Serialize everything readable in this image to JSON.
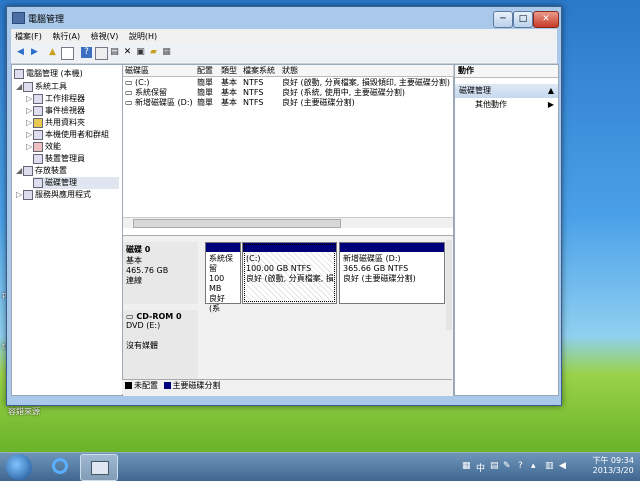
{
  "window": {
    "title": "電腦管理",
    "controls": {
      "minimize": "─",
      "maximize": "□",
      "close": "✕"
    }
  },
  "menu": [
    "檔案(F)",
    "執行(A)",
    "檢視(V)",
    "說明(H)"
  ],
  "toolbar_icons": [
    "back-icon",
    "forward-icon",
    "up-icon",
    "show-hide-tree-icon",
    "help-icon",
    "properties-icon",
    "connect-icon",
    "delete-icon",
    "open-icon",
    "export-icon",
    "settings-icon"
  ],
  "tree": [
    {
      "label": "電腦管理 (本機)",
      "level": 0
    },
    {
      "label": "系統工具",
      "level": 1
    },
    {
      "label": "工作排程器",
      "level": 2
    },
    {
      "label": "事件檢視器",
      "level": 2
    },
    {
      "label": "共用資料夾",
      "level": 2
    },
    {
      "label": "本機使用者和群組",
      "level": 2
    },
    {
      "label": "效能",
      "level": 2
    },
    {
      "label": "裝置管理員",
      "level": 2
    },
    {
      "label": "存放裝置",
      "level": 1
    },
    {
      "label": "磁碟管理",
      "level": 2
    },
    {
      "label": "服務與應用程式",
      "level": 1
    }
  ],
  "volume_table": {
    "headers": [
      "磁碟區",
      "配置",
      "類型",
      "檔案系統",
      "狀態"
    ],
    "rows": [
      [
        "(C:)",
        "簡單",
        "基本",
        "NTFS",
        "良好 (啟動, 分頁檔案, 損毀傾印, 主要磁碟分割)"
      ],
      [
        "系統保留",
        "簡單",
        "基本",
        "NTFS",
        "良好 (系統, 使用中, 主要磁碟分割)"
      ],
      [
        "新增磁碟區 (D:)",
        "簡單",
        "基本",
        "NTFS",
        "良好 (主要磁碟分割)"
      ]
    ]
  },
  "disks": [
    {
      "name": "磁碟 0",
      "type": "基本",
      "size": "465.76 GB",
      "status": "連線",
      "partitions": [
        {
          "name": "系統保留",
          "size": "100 MB",
          "status": "良好 (系"
        },
        {
          "name": "(C:)",
          "size": "100.00 GB NTFS",
          "status": "良好 (啟動, 分頁檔案, 損"
        },
        {
          "name": "新增磁碟區 (D:)",
          "size": "365.66 GB NTFS",
          "status": "良好 (主要磁碟分割)"
        }
      ]
    },
    {
      "name": "CD-ROM 0",
      "type": "DVD (E:)",
      "status": "沒有媒體"
    }
  ],
  "legend": [
    {
      "label": "未配置",
      "color": "#000000"
    },
    {
      "label": "主要磁碟分割",
      "color": "#00007a"
    }
  ],
  "actions": {
    "header": "動作",
    "section": "磁碟管理",
    "items": [
      "其他動作"
    ]
  },
  "desktop": {
    "side_text": "P",
    "side_text2": "ti",
    "bottom_left": "容錯來源"
  },
  "taskbar": {
    "time": "下午 09:34",
    "date": "2013/3/20",
    "ime": "中"
  },
  "colors": {
    "primary_partition": "#00007a",
    "window_frame": "#a9c8ea"
  }
}
